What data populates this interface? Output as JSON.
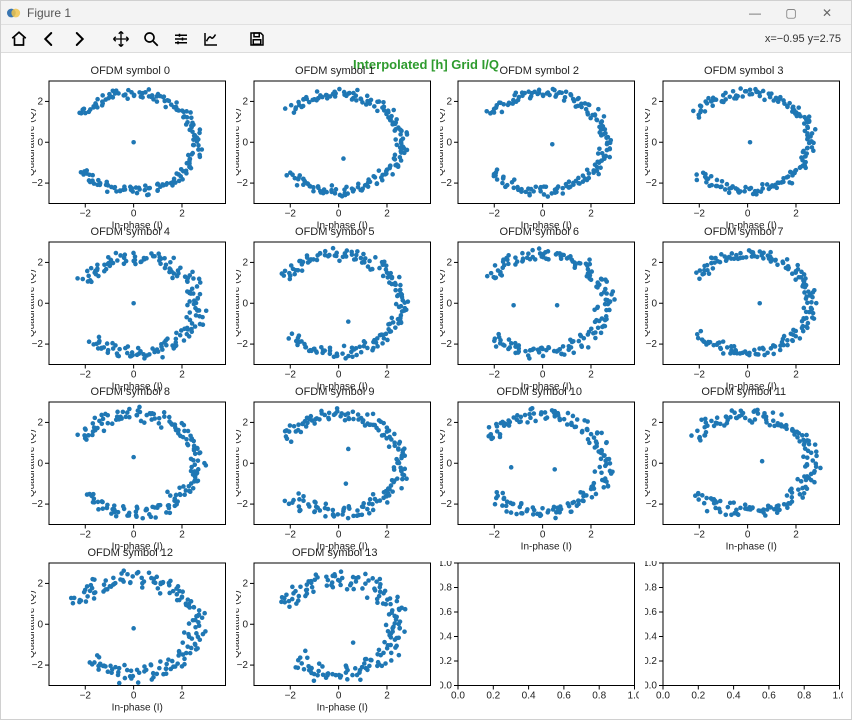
{
  "window": {
    "title": "Figure 1",
    "minimize": "—",
    "maximize": "▢",
    "close": "✕"
  },
  "toolbar": {
    "coord": "x=−0.95 y=2.75"
  },
  "suptitle": "Interpolated [h] Grid I/Q",
  "axis_common": {
    "xlabel": "In-phase (I)",
    "ylabel": "Quadrature (Q)",
    "xlim": [
      -3.5,
      3.8
    ],
    "ylim": [
      -3.0,
      3.0
    ],
    "xticks": [
      -2,
      0,
      2
    ],
    "yticks": [
      -2,
      0,
      2
    ]
  },
  "empty_axis": {
    "xlim": [
      0.0,
      1.0
    ],
    "ylim": [
      0.0,
      1.0
    ],
    "xticks": [
      0.0,
      0.2,
      0.4,
      0.6,
      0.8,
      1.0
    ],
    "yticks": [
      0.0,
      0.2,
      0.4,
      0.6,
      0.8,
      1.0
    ]
  },
  "chart_data": [
    {
      "title": "OFDM symbol 0",
      "type": "scatter",
      "arc_start_deg": 215,
      "arc_end_deg": 505,
      "radius": 2.6,
      "noise": 0.2,
      "n": 170,
      "center": [
        0.0,
        0.0
      ],
      "extra": [
        [
          0.0,
          0.0
        ]
      ]
    },
    {
      "title": "OFDM symbol 1",
      "type": "scatter",
      "arc_start_deg": 220,
      "arc_end_deg": 500,
      "radius": 2.6,
      "noise": 0.22,
      "n": 170,
      "center": [
        0.0,
        0.0
      ],
      "extra": [
        [
          0.2,
          -0.8
        ]
      ]
    },
    {
      "title": "OFDM symbol 2",
      "type": "scatter",
      "arc_start_deg": 218,
      "arc_end_deg": 505,
      "radius": 2.6,
      "noise": 0.22,
      "n": 170,
      "center": [
        0.0,
        0.0
      ],
      "extra": [
        [
          0.4,
          -0.1
        ]
      ]
    },
    {
      "title": "OFDM symbol 3",
      "type": "scatter",
      "arc_start_deg": 220,
      "arc_end_deg": 505,
      "radius": 2.6,
      "noise": 0.22,
      "n": 170,
      "center": [
        0.0,
        0.0
      ],
      "extra": [
        [
          0.1,
          0.0
        ]
      ]
    },
    {
      "title": "OFDM symbol 4",
      "type": "scatter",
      "arc_start_deg": 225,
      "arc_end_deg": 510,
      "radius": 2.55,
      "noise": 0.3,
      "n": 170,
      "center": [
        0.1,
        -0.1
      ],
      "extra": [
        [
          0.0,
          0.0
        ]
      ]
    },
    {
      "title": "OFDM symbol 5",
      "type": "scatter",
      "arc_start_deg": 222,
      "arc_end_deg": 508,
      "radius": 2.6,
      "noise": 0.25,
      "n": 170,
      "center": [
        0.0,
        0.0
      ],
      "extra": [
        [
          0.4,
          -0.9
        ]
      ]
    },
    {
      "title": "OFDM symbol 6",
      "type": "scatter",
      "arc_start_deg": 220,
      "arc_end_deg": 508,
      "radius": 2.6,
      "noise": 0.28,
      "n": 170,
      "center": [
        0.0,
        0.0
      ],
      "extra": [
        [
          -1.2,
          -0.1
        ],
        [
          0.6,
          -0.1
        ]
      ]
    },
    {
      "title": "OFDM symbol 7",
      "type": "scatter",
      "arc_start_deg": 220,
      "arc_end_deg": 505,
      "radius": 2.6,
      "noise": 0.25,
      "n": 170,
      "center": [
        0.0,
        0.0
      ],
      "extra": [
        [
          0.5,
          -0.0
        ]
      ]
    },
    {
      "title": "OFDM symbol 8",
      "type": "scatter",
      "arc_start_deg": 222,
      "arc_end_deg": 508,
      "radius": 2.6,
      "noise": 0.3,
      "n": 170,
      "center": [
        0.0,
        0.0
      ],
      "extra": [
        [
          0.0,
          0.3
        ],
        [
          1.4,
          -1.4
        ]
      ]
    },
    {
      "title": "OFDM symbol 9",
      "type": "scatter",
      "arc_start_deg": 222,
      "arc_end_deg": 508,
      "radius": 2.6,
      "noise": 0.28,
      "n": 170,
      "center": [
        0.0,
        0.0
      ],
      "extra": [
        [
          0.4,
          0.7
        ],
        [
          0.3,
          -1.0
        ]
      ]
    },
    {
      "title": "OFDM symbol 10",
      "type": "scatter",
      "arc_start_deg": 220,
      "arc_end_deg": 510,
      "radius": 2.6,
      "noise": 0.3,
      "n": 170,
      "center": [
        0.0,
        0.0
      ],
      "extra": [
        [
          -1.3,
          -0.2
        ],
        [
          0.5,
          -0.3
        ]
      ]
    },
    {
      "title": "OFDM symbol 11",
      "type": "scatter",
      "arc_start_deg": 218,
      "arc_end_deg": 508,
      "radius": 2.6,
      "noise": 0.3,
      "n": 170,
      "center": [
        0.0,
        0.0
      ],
      "extra": [
        [
          0.6,
          0.1
        ]
      ]
    },
    {
      "title": "OFDM symbol 12",
      "type": "scatter",
      "arc_start_deg": 225,
      "arc_end_deg": 515,
      "radius": 2.55,
      "noise": 0.35,
      "n": 170,
      "center": [
        0.0,
        -0.1
      ],
      "extra": [
        [
          0.0,
          -0.2
        ]
      ]
    },
    {
      "title": "OFDM symbol 13",
      "type": "scatter",
      "arc_start_deg": 225,
      "arc_end_deg": 515,
      "radius": 2.5,
      "noise": 0.38,
      "n": 170,
      "center": [
        0.0,
        -0.1
      ],
      "extra": [
        [
          0.6,
          -0.9
        ]
      ]
    },
    {
      "title": "",
      "type": "empty"
    },
    {
      "title": "",
      "type": "empty"
    }
  ]
}
